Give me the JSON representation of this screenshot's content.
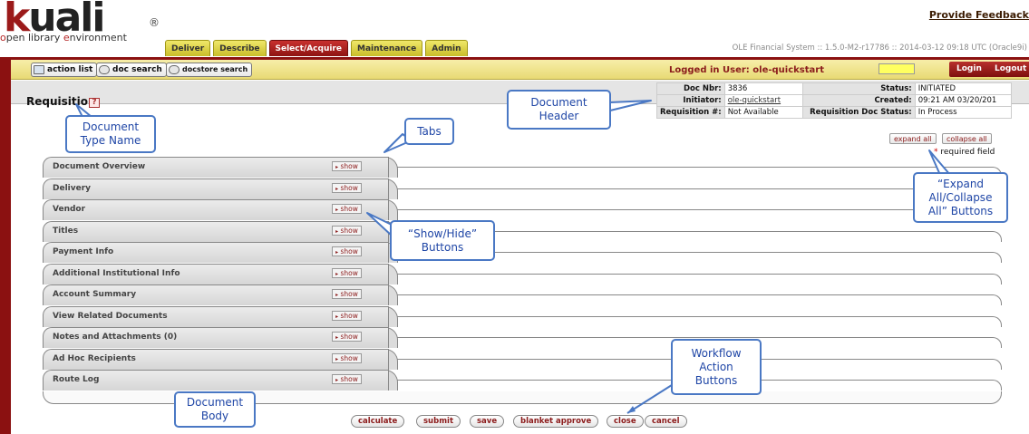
{
  "header": {
    "logo_text": "kuali",
    "logo_mark": "®",
    "tagline_parts": [
      "o",
      "pen library ",
      "e",
      "nvironment"
    ],
    "feedback_link": "Provide Feedback",
    "tabs": [
      {
        "label": "Deliver",
        "active": false
      },
      {
        "label": "Describe",
        "active": false
      },
      {
        "label": "Select/Acquire",
        "active": true
      },
      {
        "label": "Maintenance",
        "active": false
      },
      {
        "label": "Admin",
        "active": false
      }
    ],
    "system_info": "OLE Financial System :: 1.5.0-M2-r17786 :: 2014-03-12 09:18 UTC (Oracle9i)"
  },
  "toolbar": {
    "action_list": "action list",
    "doc_search": "doc search",
    "docstore_search": "docstore search",
    "logged_in": "Logged in User: ole-quickstart",
    "login": "Login",
    "logout": "Logout"
  },
  "document": {
    "type_name": "Requisition",
    "help_icon": "?",
    "header": {
      "doc_nbr_label": "Doc Nbr:",
      "doc_nbr": "3836",
      "status_label": "Status:",
      "status": "INITIATED",
      "initiator_label": "Initiator:",
      "initiator": "ole-quickstart",
      "created_label": "Created:",
      "created": "09:21 AM 03/20/201",
      "req_num_label": "Requisition #:",
      "req_num": "Not Available",
      "req_status_label": "Requisition Doc Status:",
      "req_status": "In Process"
    },
    "expand_all": "expand all",
    "collapse_all": "collapse all",
    "required_star": "*",
    "required_note": " required field",
    "show_label": "show",
    "show_arrow": "▸",
    "panels": [
      "Document Overview",
      "Delivery",
      "Vendor",
      "Titles",
      "Payment Info",
      "Additional Institutional Info",
      "Account Summary",
      "View Related Documents",
      "Notes and Attachments (0)",
      "Ad Hoc Recipients",
      "Route Log"
    ],
    "actions": [
      "calculate",
      "submit",
      "save",
      "blanket approve",
      "close",
      "cancel"
    ]
  },
  "callouts": {
    "doc_type": "Document Type Name",
    "doc_header": "Document Header",
    "tabs": "Tabs",
    "show_hide": "“Show/Hide” Buttons",
    "expand_collapse": "“Expand All/Collapse All” Buttons",
    "workflow": "Workflow Action Buttons",
    "doc_body": "Document Body"
  },
  "colors": {
    "brand_red": "#8b1111",
    "tab_yellow": "#e8da74",
    "callout_blue": "#4a78c4"
  }
}
